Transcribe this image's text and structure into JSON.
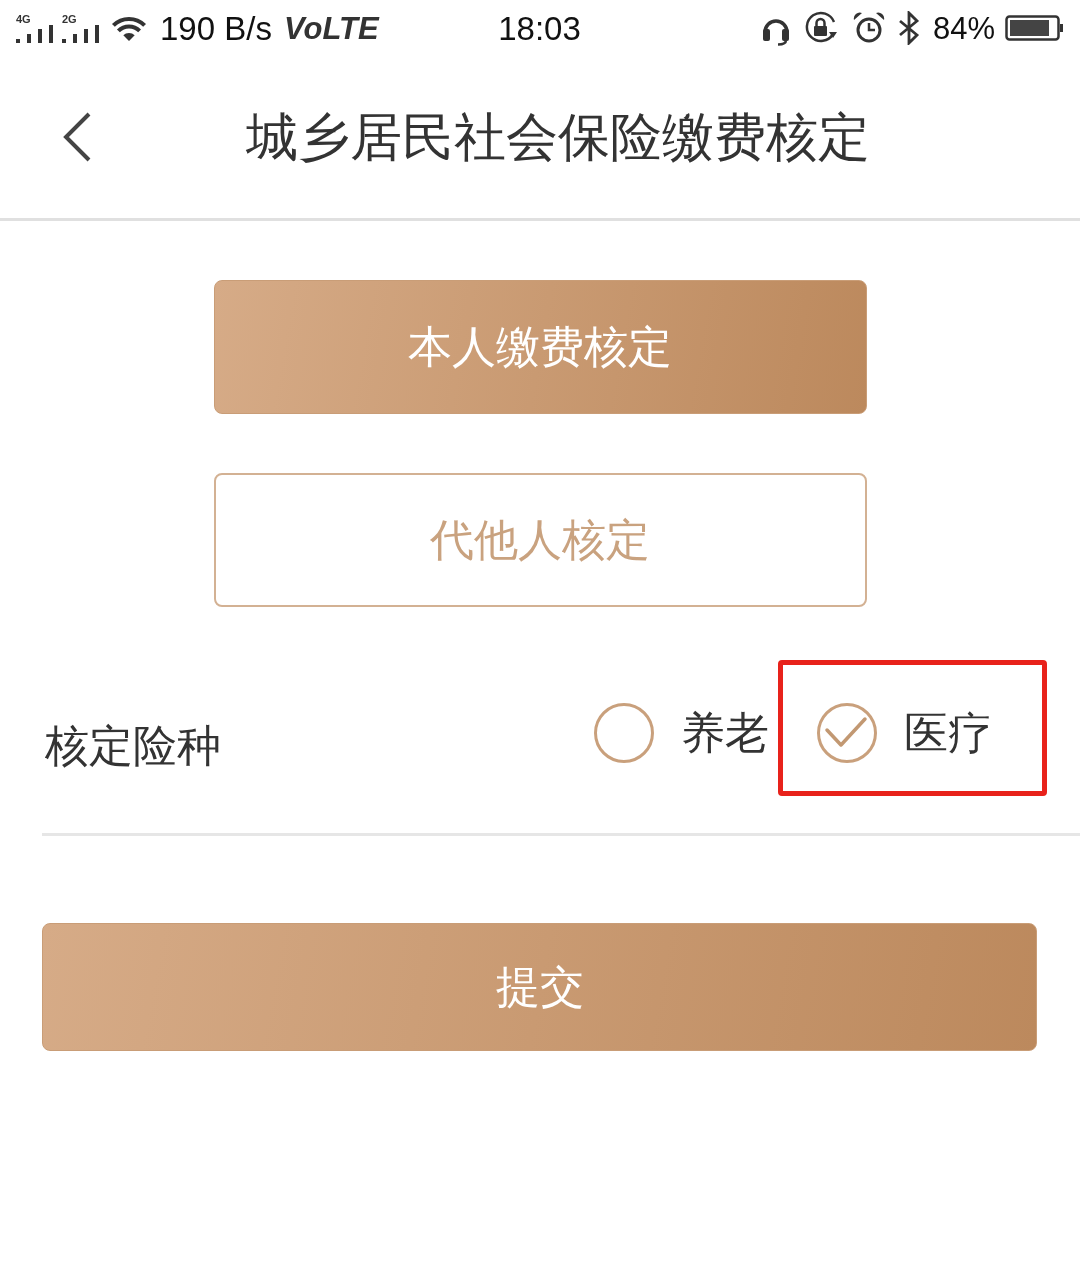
{
  "status_bar": {
    "signals": [
      {
        "network": "4G"
      },
      {
        "network": "2G"
      }
    ],
    "speed": "190 B/s",
    "volte": "VoLTE",
    "time": "18:03",
    "battery": "84%"
  },
  "header": {
    "title": "城乡居民社会保险缴费核定"
  },
  "actions": [
    {
      "label": "本人缴费核定",
      "kind": "filled"
    },
    {
      "label": "代他人核定",
      "kind": "outline"
    }
  ],
  "insurance_type": {
    "label": "核定险种",
    "options": [
      {
        "label": "养老",
        "selected": false,
        "highlighted": false
      },
      {
        "label": "医疗",
        "selected": true,
        "highlighted": true
      }
    ]
  },
  "submit": {
    "label": "提交"
  }
}
